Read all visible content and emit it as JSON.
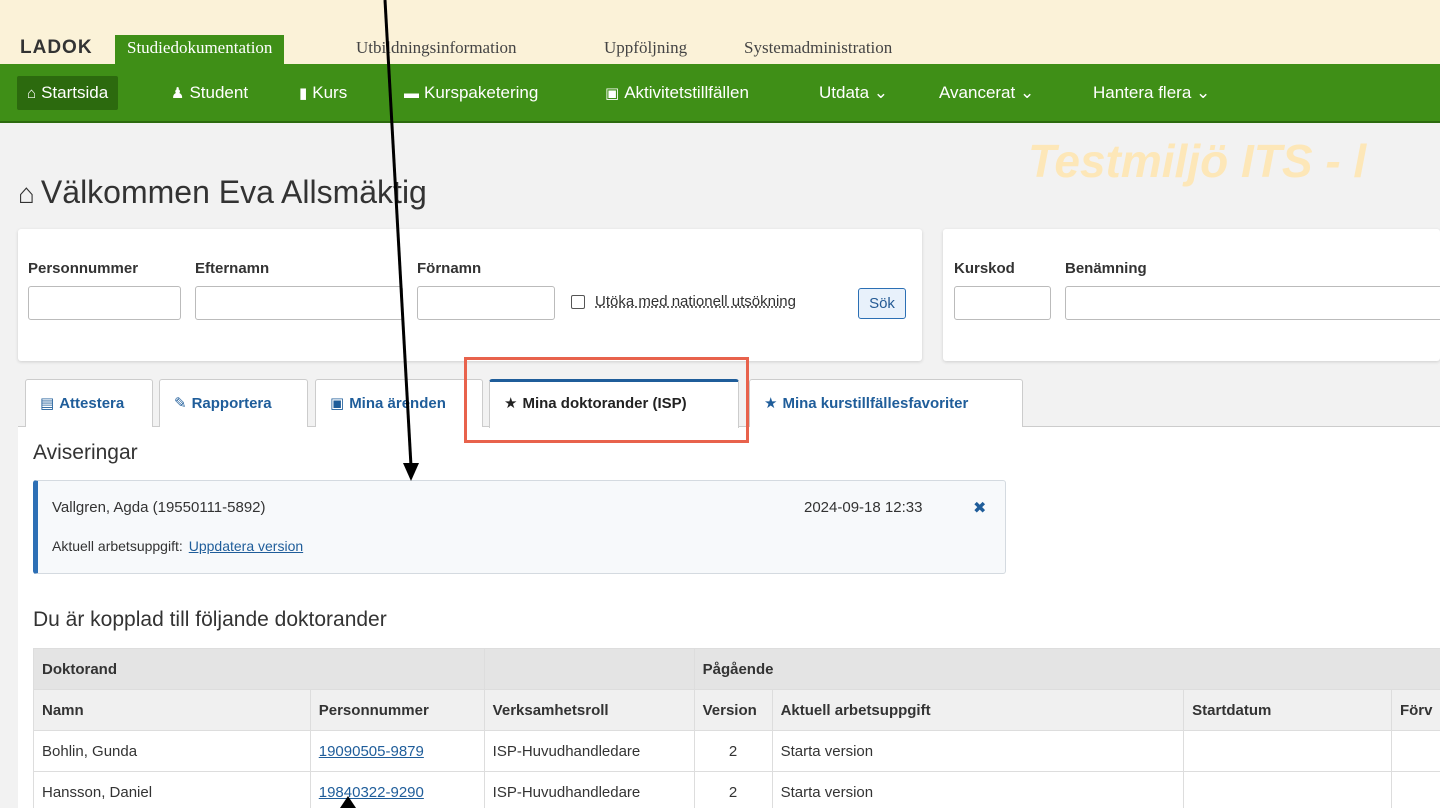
{
  "app": {
    "logo": "LADOK",
    "modules": [
      "Studiedokumentation",
      "Utbildningsinformation",
      "Uppföljning",
      "Systemadministration"
    ]
  },
  "nav": {
    "items": [
      {
        "label": "Startsida",
        "icon": "home-icon"
      },
      {
        "label": "Student",
        "icon": "user-icon"
      },
      {
        "label": "Kurs",
        "icon": "book-icon"
      },
      {
        "label": "Kurspaketering",
        "icon": "folder-icon"
      },
      {
        "label": "Aktivitetstillfällen",
        "icon": "calendar-icon"
      },
      {
        "label": "Utdata ⌄"
      },
      {
        "label": "Avancerat ⌄"
      },
      {
        "label": "Hantera flera ⌄"
      }
    ]
  },
  "watermark": "Testmiljö ITS - l",
  "welcome": "Välkommen Eva Allsmäktig",
  "search_student": {
    "personnummer_label": "Personnummer",
    "efternamn_label": "Efternamn",
    "fornamn_label": "Förnamn",
    "national_label": "Utöka med nationell utsökning",
    "search_button": "Sök"
  },
  "search_course": {
    "kurskod_label": "Kurskod",
    "benamning_label": "Benämning"
  },
  "tabs": [
    {
      "label": "Attestera",
      "icon": "archive-icon"
    },
    {
      "label": "Rapportera",
      "icon": "pencil-icon"
    },
    {
      "label": "Mina ärenden",
      "icon": "inbox-icon"
    },
    {
      "label": "Mina doktorander (ISP)",
      "icon": "star-icon"
    },
    {
      "label": "Mina kurstillfällesfavoriter",
      "icon": "star-icon"
    }
  ],
  "notices": {
    "heading": "Aviseringar",
    "item": {
      "who": "Vallgren, Agda (19550111-5892)",
      "timestamp": "2024-09-18 12:33",
      "task_label": "Aktuell arbetsuppgift:",
      "task_link": "Uppdatera version"
    }
  },
  "doktorander": {
    "heading": "Du är kopplad till följande doktorander",
    "group_headers": [
      "Doktorand",
      "",
      "Pågående"
    ],
    "columns": [
      "Namn",
      "Personnummer",
      "Verksamhetsroll",
      "Version",
      "Aktuell arbetsuppgift",
      "Startdatum",
      "Förv"
    ],
    "rows": [
      {
        "namn": "Bohlin, Gunda",
        "pnr": "19090505-9879",
        "roll": "ISP-Huvudhandledare",
        "version": "2",
        "uppgift": "Starta version",
        "start": "",
        "forv": ""
      },
      {
        "namn": "Hansson, Daniel",
        "pnr": "19840322-9290",
        "roll": "ISP-Huvudhandledare",
        "version": "2",
        "uppgift": "Starta version",
        "start": "",
        "forv": ""
      }
    ]
  }
}
